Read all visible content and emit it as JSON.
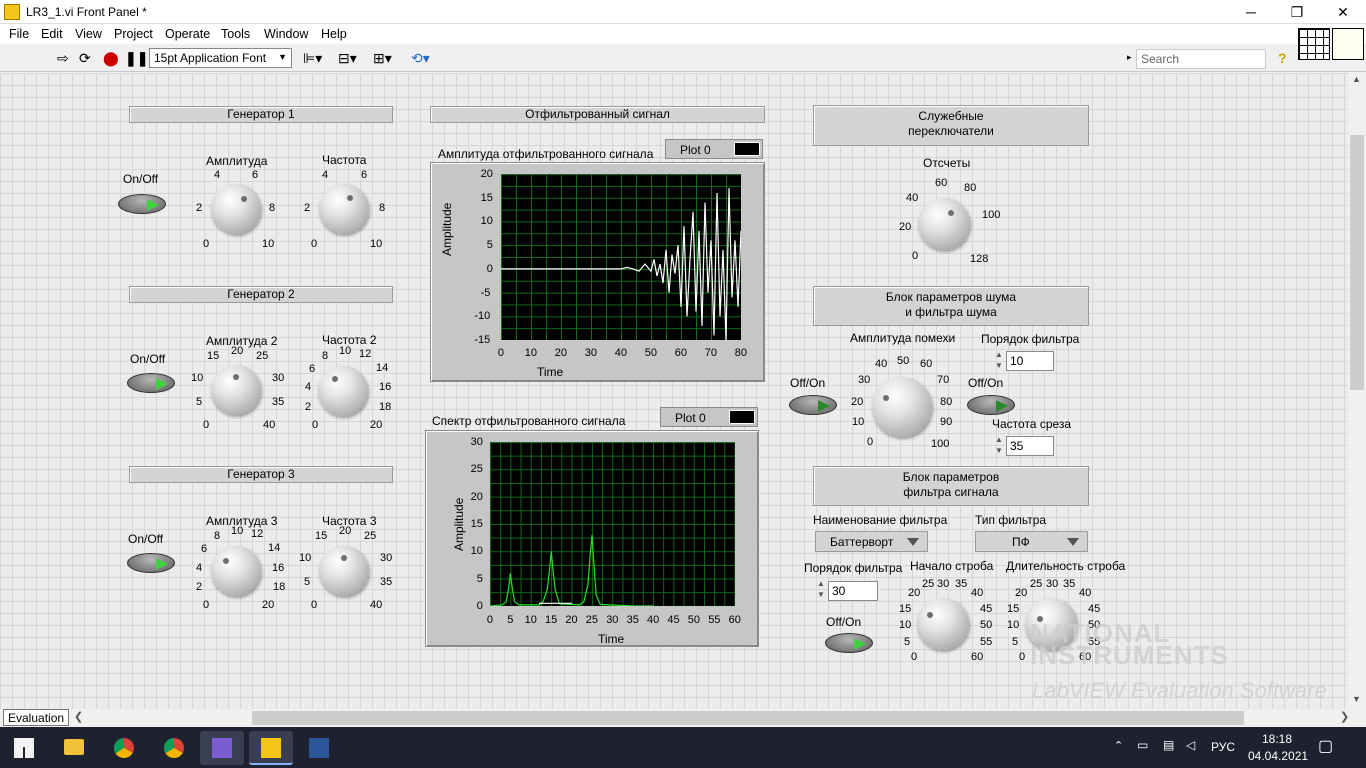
{
  "window": {
    "title": "LR3_1.vi Front Panel *",
    "minimize": "─",
    "restore": "❐",
    "close": "✕"
  },
  "menu": [
    "File",
    "Edit",
    "View",
    "Project",
    "Operate",
    "Tools",
    "Window",
    "Help"
  ],
  "toolbar": {
    "font": "15pt Application Font",
    "search_placeholder": "Search",
    "help": "?"
  },
  "gen1": {
    "title": "Генератор 1",
    "onoff": "On/Off",
    "amp": "Амплитуда",
    "freq": "Частота",
    "amp_ticks": [
      "4",
      "6",
      "2",
      "8",
      "0",
      "10"
    ],
    "freq_ticks": [
      "4",
      "6",
      "2",
      "8",
      "0",
      "10"
    ]
  },
  "gen2": {
    "title": "Генератор 2",
    "onoff": "On/Off",
    "amp": "Амплитуда 2",
    "freq": "Частота 2",
    "amp_ticks": [
      "15",
      "20",
      "25",
      "10",
      "30",
      "5",
      "35",
      "0",
      "40"
    ],
    "freq_ticks": [
      "8",
      "10",
      "12",
      "6",
      "14",
      "4",
      "16",
      "2",
      "18",
      "0",
      "20"
    ]
  },
  "gen3": {
    "title": "Генератор 3",
    "onoff": "On/Off",
    "amp": "Амплитуда 3",
    "freq": "Частота 3",
    "amp_ticks": [
      "8",
      "10",
      "12",
      "6",
      "14",
      "4",
      "16",
      "2",
      "18",
      "0",
      "20"
    ],
    "freq_ticks": [
      "15",
      "20",
      "25",
      "10",
      "30",
      "5",
      "35",
      "0",
      "40"
    ]
  },
  "graph1": {
    "section": "Отфильтрованный сигнал",
    "label": "Амплитуда отфильтрованного сигнала",
    "legend": "Plot 0",
    "xlabel": "Time",
    "ylabel": "Amplitude",
    "y_ticks": [
      "20",
      "15",
      "10",
      "5",
      "0",
      "-5",
      "-10",
      "-15"
    ],
    "x_ticks": [
      "0",
      "10",
      "20",
      "30",
      "40",
      "50",
      "60",
      "70",
      "80"
    ]
  },
  "graph2": {
    "label": "Спектр отфильтрованного сигнала",
    "legend": "Plot 0",
    "xlabel": "Time",
    "ylabel": "Amplitude",
    "y_ticks": [
      "30",
      "25",
      "20",
      "15",
      "10",
      "5",
      "0"
    ],
    "x_ticks": [
      "0",
      "5",
      "10",
      "15",
      "20",
      "25",
      "30",
      "35",
      "40",
      "45",
      "50",
      "55",
      "60"
    ]
  },
  "service": {
    "title1": "Служебные",
    "title2": "переключатели",
    "samples": "Отсчеты",
    "ticks": [
      "60",
      "80",
      "40",
      "100",
      "20",
      "0",
      "128"
    ]
  },
  "noise": {
    "title1": "Блок параметров шума",
    "title2": "и фильтра шума",
    "amp": "Амплитуда помехи",
    "amp_ticks": [
      "50",
      "40",
      "60",
      "30",
      "70",
      "20",
      "80",
      "10",
      "90",
      "0",
      "100"
    ],
    "order_label": "Порядок фильтра",
    "order_value": "10",
    "onoff1": "Off/On",
    "onoff2": "Off/On",
    "cutoff_label": "Частота среза",
    "cutoff_value": "35"
  },
  "signal_filter": {
    "title1": "Блок параметров",
    "title2": "фильтра сигнала",
    "name_label": "Наименование фильтра",
    "name_value": "Баттерворт",
    "type_label": "Тип фильтра",
    "type_value": "ПФ",
    "order_label": "Порядок фильтра",
    "order_value": "30",
    "onoff": "Off/On",
    "start_label": "Начало строба",
    "dur_label": "Длительность строба",
    "start_ticks": [
      "25",
      "30",
      "35",
      "20",
      "40",
      "15",
      "45",
      "10",
      "50",
      "5",
      "55",
      "0",
      "60"
    ],
    "dur_ticks": [
      "25",
      "30",
      "35",
      "20",
      "40",
      "15",
      "45",
      "10",
      "50",
      "5",
      "55",
      "0",
      "60"
    ]
  },
  "watermark": {
    "line1": "NATIONAL",
    "line2": "INSTRUMENTS",
    "line3": "LabVIEW Evaluation Software"
  },
  "status": {
    "tab": "Evaluation"
  },
  "taskbar": {
    "lang": "РУС",
    "time": "18:18",
    "date": "04.04.2021"
  },
  "chart_data": [
    {
      "type": "line",
      "title": "Амплитуда отфильтрованного сигнала",
      "xlabel": "Time",
      "ylabel": "Amplitude",
      "xlim": [
        0,
        80
      ],
      "ylim": [
        -15,
        20
      ],
      "series": [
        {
          "name": "Plot 0",
          "x": [
            0,
            38,
            40,
            42,
            44,
            46,
            48,
            50,
            51,
            52,
            53,
            54,
            55,
            56,
            57,
            58,
            59,
            60,
            61,
            62,
            63,
            64,
            65,
            66,
            67,
            68,
            69,
            70,
            71,
            72,
            73,
            74,
            75,
            76,
            77,
            78,
            79,
            80
          ],
          "y": [
            0,
            0,
            0,
            0.3,
            0,
            -0.5,
            1,
            -0.5,
            2,
            -1.5,
            1,
            -3,
            4,
            -5,
            3,
            -1,
            5,
            -8,
            9,
            -10,
            2,
            12,
            -9,
            8,
            -12,
            14,
            -5,
            6,
            -14,
            16,
            -10,
            4,
            -15,
            17,
            -6,
            6,
            -8,
            8
          ]
        }
      ]
    },
    {
      "type": "line",
      "title": "Спектр отфильтрованного сигнала",
      "xlabel": "Time",
      "ylabel": "Amplitude",
      "xlim": [
        0,
        60
      ],
      "ylim": [
        0,
        30
      ],
      "series": [
        {
          "name": "Plot 0",
          "x": [
            0,
            3,
            4,
            4.5,
            5,
            5.5,
            6,
            7,
            12,
            13,
            14,
            14.5,
            15,
            15.5,
            16,
            17,
            22,
            23,
            24,
            24.5,
            25,
            25.5,
            26,
            27,
            35,
            40
          ],
          "y": [
            0,
            0.2,
            0.8,
            3,
            6,
            3,
            0.8,
            0.2,
            0.2,
            0.8,
            3,
            6,
            10,
            6,
            3,
            0.4,
            0.2,
            0.8,
            4,
            9,
            13,
            7,
            2,
            0.3,
            0,
            0
          ]
        },
        {
          "name": "",
          "x": [
            12,
            20
          ],
          "y": [
            0.5,
            0.5
          ]
        }
      ]
    }
  ]
}
